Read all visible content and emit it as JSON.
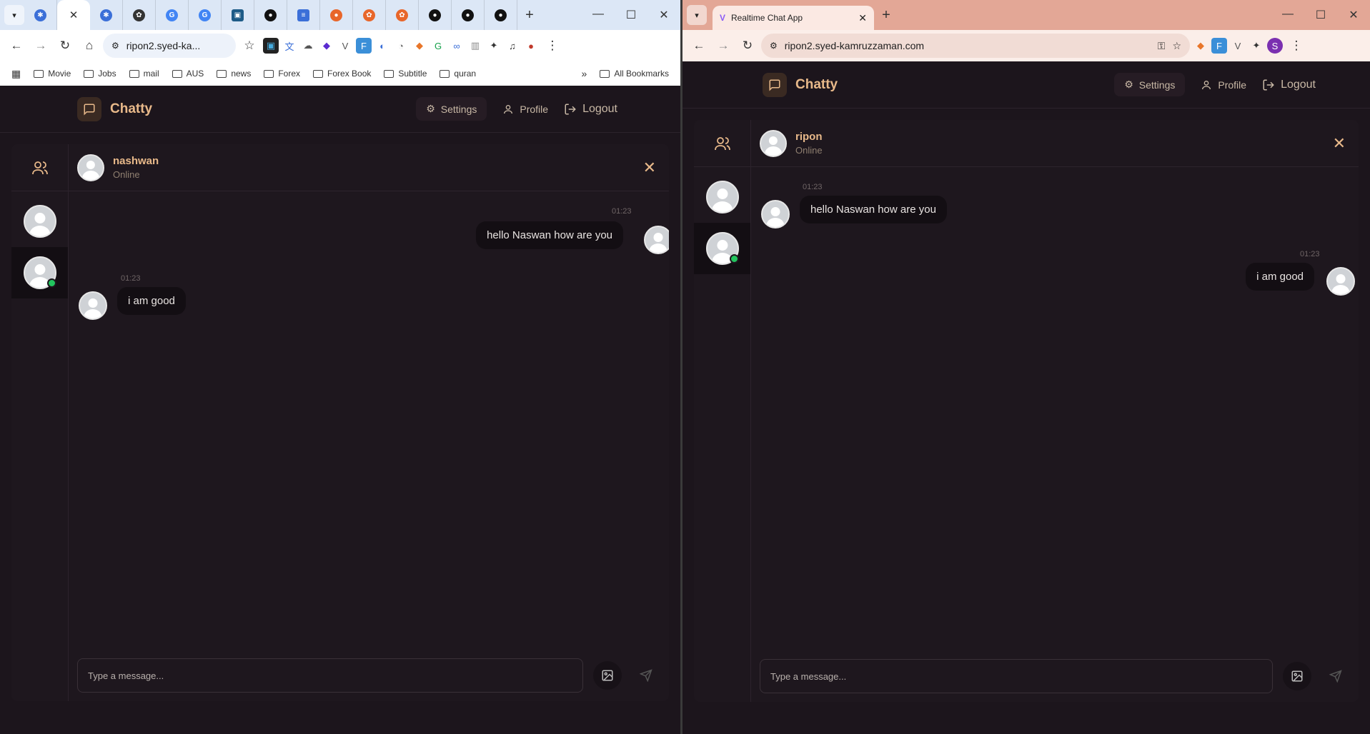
{
  "left_window": {
    "url": "ripon2.syed-ka...",
    "bookmarks": [
      "Movie",
      "Jobs",
      "mail",
      "AUS",
      "news",
      "Forex",
      "Forex Book",
      "Subtitle",
      "quran"
    ],
    "all_bookmarks": "All Bookmarks",
    "app": {
      "brand": "Chatty",
      "nav": {
        "settings": "Settings",
        "profile": "Profile",
        "logout": "Logout"
      },
      "chat_user": {
        "name": "nashwan",
        "status": "Online"
      },
      "messages": [
        {
          "time": "01:23",
          "text": "hello Naswan how are you",
          "side": "right"
        },
        {
          "time": "01:23",
          "text": "i am good",
          "side": "left"
        }
      ],
      "input_placeholder": "Type a message..."
    }
  },
  "right_window": {
    "tab_title": "Realtime Chat App",
    "url": "ripon2.syed-kamruzzaman.com",
    "profile_initial": "S",
    "app": {
      "brand": "Chatty",
      "nav": {
        "settings": "Settings",
        "profile": "Profile",
        "logout": "Logout"
      },
      "chat_user": {
        "name": "ripon",
        "status": "Online"
      },
      "messages": [
        {
          "time": "01:23",
          "text": "hello Naswan how are you",
          "side": "left"
        },
        {
          "time": "01:23",
          "text": "i am good",
          "side": "right"
        }
      ],
      "input_placeholder": "Type a message..."
    }
  },
  "colors": {
    "accent": "#e8b98a",
    "background": "#1c151c",
    "bubble": "#130e13",
    "online": "#22c55e"
  }
}
